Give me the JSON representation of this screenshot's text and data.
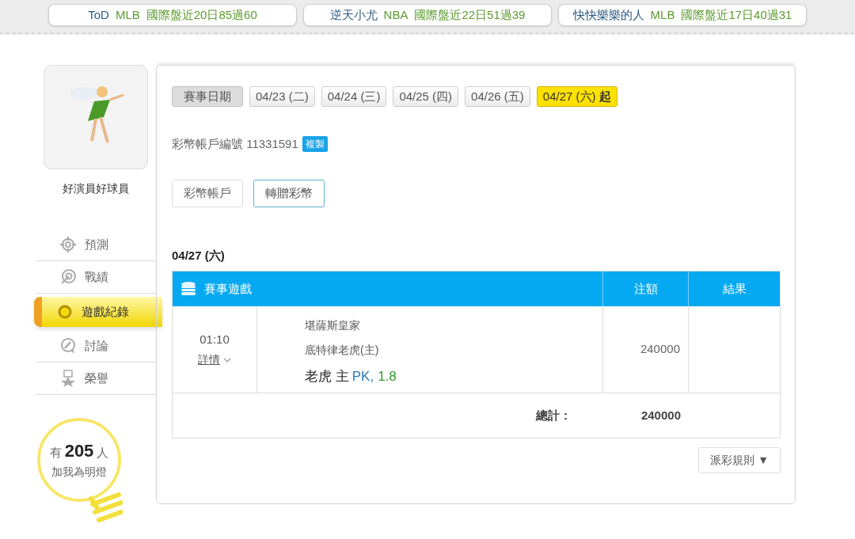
{
  "banners": [
    {
      "name": "ToD",
      "league": "MLB",
      "record": "國際盤近20日85過60"
    },
    {
      "name": "逆天小尤",
      "league": "NBA",
      "record": "國際盤近22日51過39"
    },
    {
      "name": "快快樂樂的人",
      "league": "MLB",
      "record": "國際盤近17日40過31"
    }
  ],
  "profile": {
    "name": "好演員好球員"
  },
  "nav": [
    {
      "label": "預測",
      "kind": "target",
      "selected": false
    },
    {
      "label": "戰績",
      "kind": "dart",
      "selected": false
    },
    {
      "label": "遊戲紀錄",
      "kind": "ring",
      "selected": true
    },
    {
      "label": "討論",
      "kind": "chat",
      "selected": false
    },
    {
      "label": "榮譽",
      "kind": "medal",
      "selected": false
    }
  ],
  "fans": {
    "prefix": "有",
    "count": "205",
    "suffix": "人",
    "caption": "加我為明燈"
  },
  "date_label": "賽事日期",
  "dates": [
    {
      "label": "04/23 (二)",
      "selected": false
    },
    {
      "label": "04/24 (三)",
      "selected": false
    },
    {
      "label": "04/25 (四)",
      "selected": false
    },
    {
      "label": "04/26 (五)",
      "selected": false
    },
    {
      "label": "04/27 (六) **起**",
      "selected": true
    }
  ],
  "account": {
    "label": "彩幣帳戶編號 11331591",
    "copy": "複製"
  },
  "account_tabs": [
    {
      "label": "彩幣帳戶",
      "selected": false
    },
    {
      "label": "轉贈彩幣",
      "selected": true
    }
  ],
  "day_heading": "04/27 (六)",
  "table": {
    "columns": [
      "賽事遊戲",
      "注額",
      "結果"
    ],
    "rows": [
      {
        "time": "01:10",
        "details": "詳情",
        "away": "堪薩斯皇家",
        "home": "底特律老虎(主)",
        "pick": "老虎 主",
        "handicap": "PK,",
        "odds": "1.8",
        "stake": "240000"
      }
    ],
    "total_label": "總計：",
    "total": "240000"
  },
  "rules_button": "派彩規則 ▼"
}
